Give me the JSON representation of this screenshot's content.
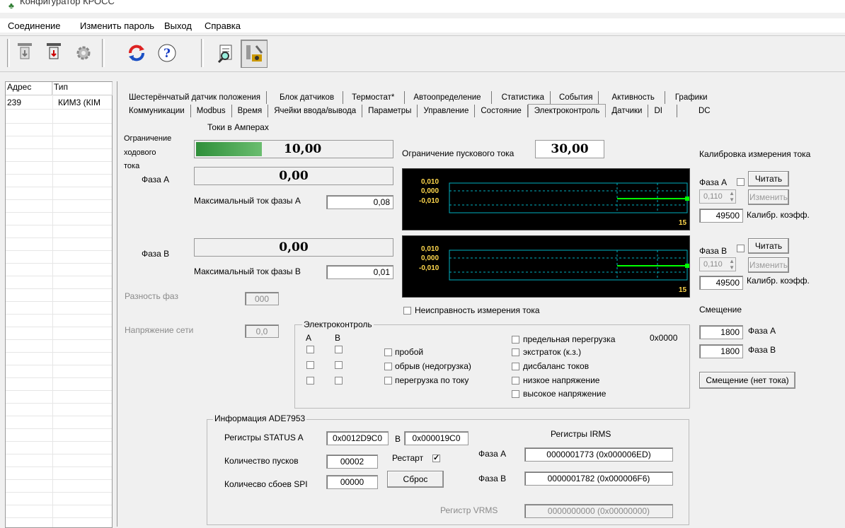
{
  "window": {
    "title": "Конфигуратор КРОСС"
  },
  "menu": [
    "Соединение",
    "Изменить пароль",
    "Выход",
    "Справка"
  ],
  "device_list": {
    "headers": {
      "address": "Адрес",
      "type": "Тип"
    },
    "rows": [
      {
        "address": "239",
        "type": "КИМ3 (КІМ"
      }
    ]
  },
  "tabs": {
    "row1": [
      "Шестерёнчатый датчик положения",
      "Блок датчиков",
      "Термостат*",
      "Автоопределение",
      "Статистика",
      "События",
      "Активность",
      "Графики"
    ],
    "row2": [
      "Коммуникации",
      "Modbus",
      "Время",
      "Ячейки ввода/вывода",
      "Параметры",
      "Управление",
      "Состояние",
      "Электроконтроль",
      "Датчики",
      "DI",
      "DC"
    ],
    "active": "Электроконтроль"
  },
  "current": {
    "header": "Токи в Амперах",
    "limit_label": "Ограничение ходового тока",
    "limit_l1": "Ограничение",
    "limit_l2": "ходового",
    "limit_l3": "тока",
    "limit_value": "10,00",
    "phase_a_label": "Фаза А",
    "phase_a_value": "0,00",
    "max_a_label": "Максимальный ток фазы А",
    "max_a_value": "0,08",
    "phase_b_label": "Фаза В",
    "phase_b_value": "0,00",
    "max_b_label": "Максимальный ток фазы В",
    "max_b_value": "0,01",
    "phase_diff_label": "Разность фаз",
    "phase_diff_value": "000",
    "voltage_label": "Напряжение сети",
    "voltage_value": "0,0"
  },
  "start_limit": {
    "label": "Ограничение пускового тока",
    "value": "30,00"
  },
  "graphs": {
    "ticks": [
      "0,010",
      "0,000",
      "-0,010"
    ],
    "corner_a": "15",
    "corner_b": "15"
  },
  "fault_measure": {
    "label": "Неисправность измерения тока"
  },
  "calibration": {
    "title": "Калибровка измерения тока",
    "phase_a": "Фаза А",
    "phase_b": "Фаза В",
    "read_button": "Читать",
    "change_button": "Изменить",
    "spin_a": "0,110",
    "spin_b": "0,110",
    "coef_a": "49500",
    "coef_b": "49500",
    "coef_label": "Калибр. коэфф.",
    "offset_title": "Смещение",
    "offset_a": "1800",
    "offset_b": "1800",
    "offset_a_label": "Фаза А",
    "offset_b_label": "Фаза В",
    "offset_button": "Смещение (нет тока)"
  },
  "electrocontrol": {
    "title": "Электроконтроль",
    "col_a": "А",
    "col_b": "В",
    "mid": [
      "пробой",
      "обрыв (недогрузка)",
      "перегрузка по току"
    ],
    "right": [
      "предельная перегрузка",
      "экстраток (к.з.)",
      "дисбаланс токов",
      "низкое напряжение",
      "высокое напряжение"
    ],
    "code": "0x0000"
  },
  "ade": {
    "title": "Информация ADE7953",
    "status_label": "Регистры STATUS A",
    "status_a": "0x0012D9C0",
    "b_label": "B",
    "status_b": "0x000019C0",
    "irms_title": "Регистры IRMS",
    "starts_label": "Количество пусков",
    "starts_value": "00002",
    "restart_label": "Рестарт",
    "spi_label": "Количесво сбоев SPI",
    "spi_value": "00000",
    "reset_button": "Сброс",
    "irms_a_label": "Фаза А",
    "irms_a": "0000001773  (0x000006ED)",
    "irms_b_label": "Фаза В",
    "irms_b": "0000001782  (0x000006F6)",
    "vrms_label": "Регистр VRMS",
    "vrms": "0000000000  (0x00000000)"
  },
  "colors": {
    "graph_bg": "#000000",
    "graph_grid": "#00b0c0",
    "graph_line": "#00ff00",
    "limit_bar": "#3a9c45"
  }
}
